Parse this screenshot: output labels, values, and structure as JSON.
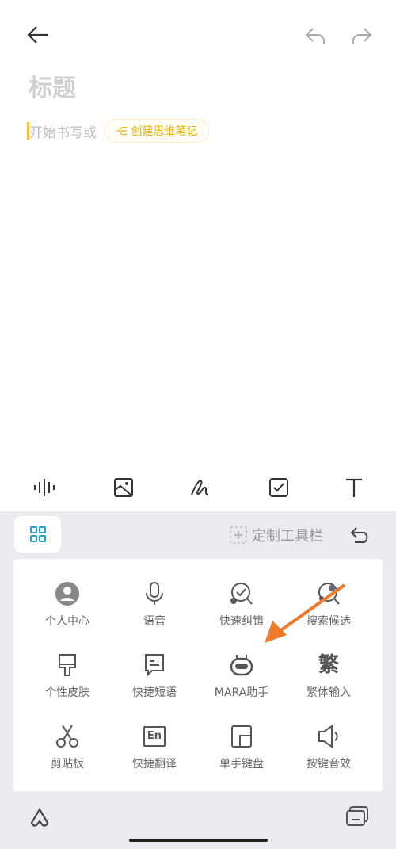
{
  "editor": {
    "title_placeholder": "标题",
    "body_placeholder": "开始书写或",
    "mindmap_chip": "创建思维笔记"
  },
  "header": {
    "icons": [
      "back-arrow-icon",
      "undo-icon",
      "redo-icon"
    ]
  },
  "toolbar": {
    "icons": [
      "voice-wave-icon",
      "image-icon",
      "handwriting-icon",
      "checkbox-icon",
      "text-format-icon"
    ]
  },
  "keyboard": {
    "customize_label": "定制工具栏",
    "items": [
      {
        "label": "个人中心",
        "icon": "user-icon"
      },
      {
        "label": "语音",
        "icon": "microphone-icon"
      },
      {
        "label": "快速纠错",
        "icon": "quick-correct-icon"
      },
      {
        "label": "搜索候选",
        "icon": "search-candidate-icon"
      },
      {
        "label": "个性皮肤",
        "icon": "skin-brush-icon"
      },
      {
        "label": "快捷短语",
        "icon": "phrase-icon"
      },
      {
        "label": "MARA助手",
        "icon": "mara-assistant-icon"
      },
      {
        "label": "繁体输入",
        "icon": "traditional-chinese-icon",
        "glyph": "繁"
      },
      {
        "label": "剪贴板",
        "icon": "scissors-icon"
      },
      {
        "label": "快捷翻译",
        "icon": "translate-icon",
        "glyph": "En"
      },
      {
        "label": "单手键盘",
        "icon": "one-hand-keyboard-icon"
      },
      {
        "label": "按键音效",
        "icon": "key-sound-icon"
      }
    ]
  },
  "colors": {
    "accent": "#2a9fc9",
    "chip": "#e8b400",
    "annotation_arrow": "#f07a2a"
  }
}
